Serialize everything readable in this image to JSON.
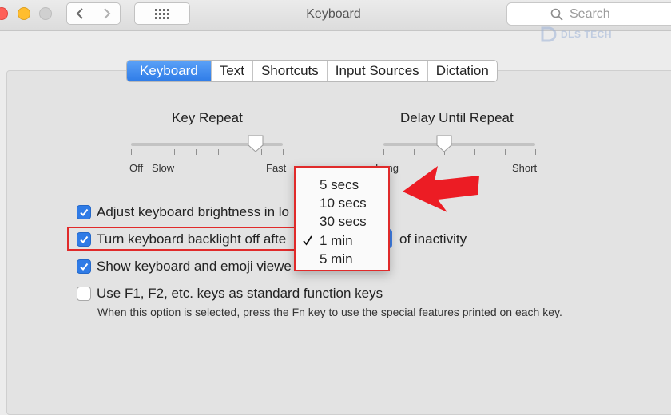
{
  "window": {
    "title": "Keyboard"
  },
  "search": {
    "placeholder": "Search"
  },
  "watermark": {
    "text": "DLS TECH"
  },
  "tabs": [
    {
      "label": "Keyboard",
      "active": true
    },
    {
      "label": "Text",
      "active": false
    },
    {
      "label": "Shortcuts",
      "active": false
    },
    {
      "label": "Input Sources",
      "active": false
    },
    {
      "label": "Dictation",
      "active": false
    }
  ],
  "key_repeat": {
    "title": "Key Repeat",
    "min_label": "Off",
    "low_label": "Slow",
    "max_label": "Fast",
    "level": 0.82
  },
  "delay_until_repeat": {
    "title": "Delay Until Repeat",
    "min_label": "Long",
    "max_label": "Short",
    "level": 0.4
  },
  "options": [
    {
      "label": "Adjust keyboard brightness in lo",
      "checked": true
    },
    {
      "label": "Turn keyboard backlight off afte",
      "checked": true
    },
    {
      "label": "Show keyboard and emoji viewe",
      "checked": true
    },
    {
      "label": "Use F1, F2, etc. keys as standard function keys",
      "checked": false
    }
  ],
  "inactivity_suffix": "of inactivity",
  "fn_note": "When this option is selected, press the Fn key to use the special features printed on each key.",
  "backlight_menu": {
    "options": [
      "5 secs",
      "10 secs",
      "30 secs",
      "1 min",
      "5 min"
    ],
    "selected": "1 min"
  },
  "colors": {
    "accent": "#2f7be6",
    "highlight": "#e02a2a"
  }
}
